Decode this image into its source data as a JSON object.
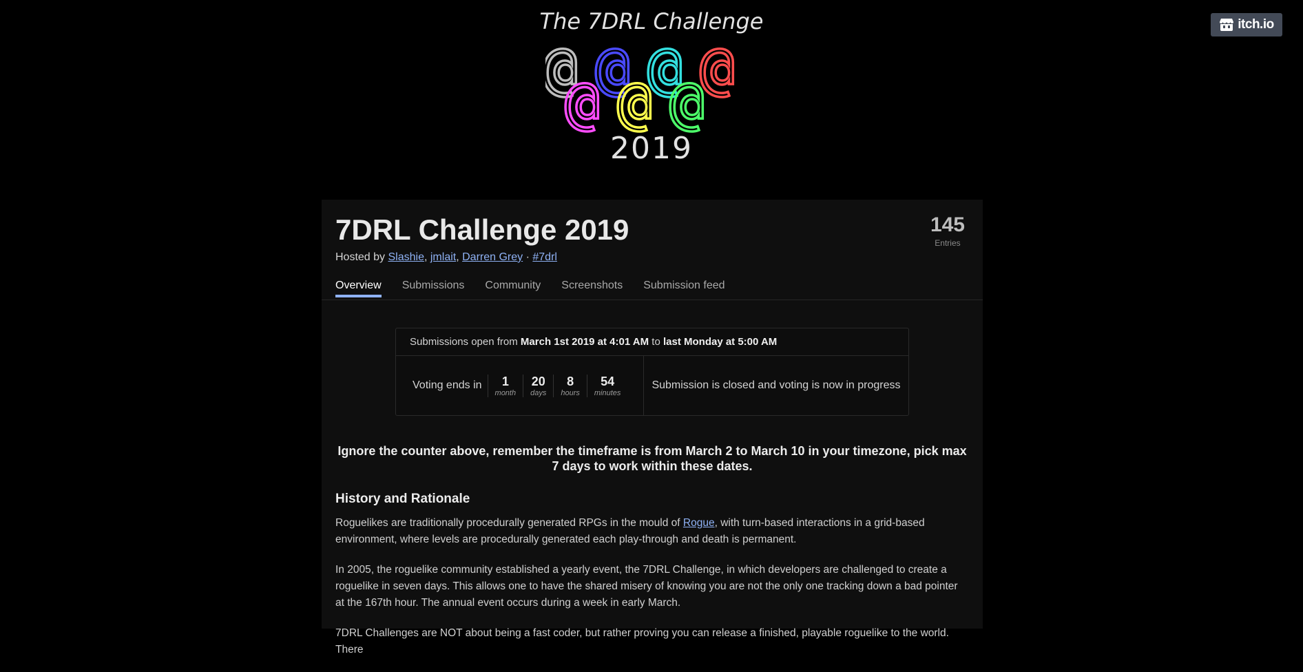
{
  "topbar": {
    "itchio_label": "itch.io",
    "itchio_icon": "itchio-logo-icon"
  },
  "banner": {
    "title": "The 7DRL Challenge",
    "symbol": "@",
    "year": "2019",
    "ring_colors": [
      "#bdbdbd",
      "#4a4aff",
      "#33e0e0",
      "#ff4d4d",
      "#ff4dff",
      "#ffff4d",
      "#4dff6a"
    ]
  },
  "jam": {
    "title": "7DRL Challenge 2019",
    "hosted_by": "Hosted by",
    "hosts": [
      "Slashie",
      "jmlait",
      "Darren Grey"
    ],
    "tag": "#7drl",
    "entries_count": "145",
    "entries_label": "Entries",
    "tabs": [
      {
        "label": "Overview",
        "active": true
      },
      {
        "label": "Submissions",
        "active": false
      },
      {
        "label": "Community",
        "active": false
      },
      {
        "label": "Screenshots",
        "active": false
      },
      {
        "label": "Submission feed",
        "active": false
      }
    ]
  },
  "timer": {
    "prefix": "Submissions open from",
    "start": "March 1st 2019 at 4:01 AM",
    "to": "to",
    "end": "last Monday at 5:00 AM",
    "voting_label": "Voting ends in",
    "units": [
      {
        "value": "1",
        "label": "month"
      },
      {
        "value": "20",
        "label": "days"
      },
      {
        "value": "8",
        "label": "hours"
      },
      {
        "value": "54",
        "label": "minutes"
      }
    ],
    "status": "Submission is closed and voting is now in progress"
  },
  "content": {
    "notice": "Ignore the counter above, remember the timeframe is from March 2 to March 10 in your timezone, pick max 7 days to work within these dates.",
    "heading": "History and Rationale",
    "p1_before": "Roguelikes are traditionally procedurally generated RPGs in the mould of ",
    "p1_link": "Rogue",
    "p1_after": ", with turn-based interactions in a grid-based environment, where levels are procedurally generated each play-through and death is permanent.",
    "p2": "In 2005, the roguelike community established a yearly event, the 7DRL Challenge, in which developers are challenged to create a roguelike in seven days. This allows one to have the shared misery of knowing you are not the only one tracking down a bad pointer at the 167th hour.  The annual event occurs during a week in early March.",
    "p3": "7DRL Challenges are NOT about being a fast coder, but rather proving you can release a finished, playable roguelike to the world. There"
  }
}
